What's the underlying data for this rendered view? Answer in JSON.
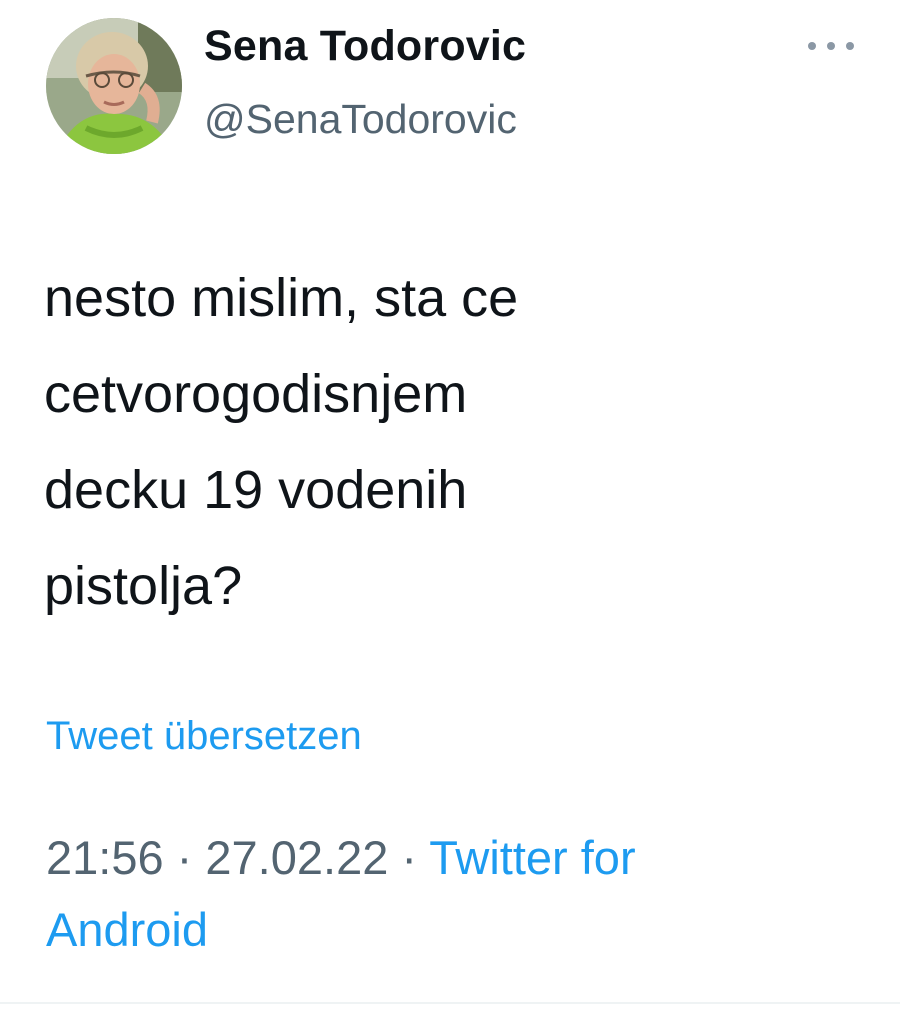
{
  "author": {
    "display_name": "Sena Todorovic",
    "handle": "@SenaTodorovic",
    "avatar_icon": "profile-photo"
  },
  "more_icon": "ellipsis-icon",
  "tweet": {
    "lines": [
      "nesto mislim, sta ce",
      "cetvorogodisnjem",
      "decku 19 vodenih",
      "pistolja?"
    ]
  },
  "translate_label": "Tweet übersetzen",
  "meta": {
    "time": "21:56",
    "separator": " · ",
    "date": "27.02.22",
    "source_line1": "Twitter for",
    "source_line2": "Android"
  },
  "colors": {
    "link": "#1d9bf0",
    "secondary_text": "#536471",
    "primary_text": "#0f1419",
    "background": "#ffffff"
  }
}
